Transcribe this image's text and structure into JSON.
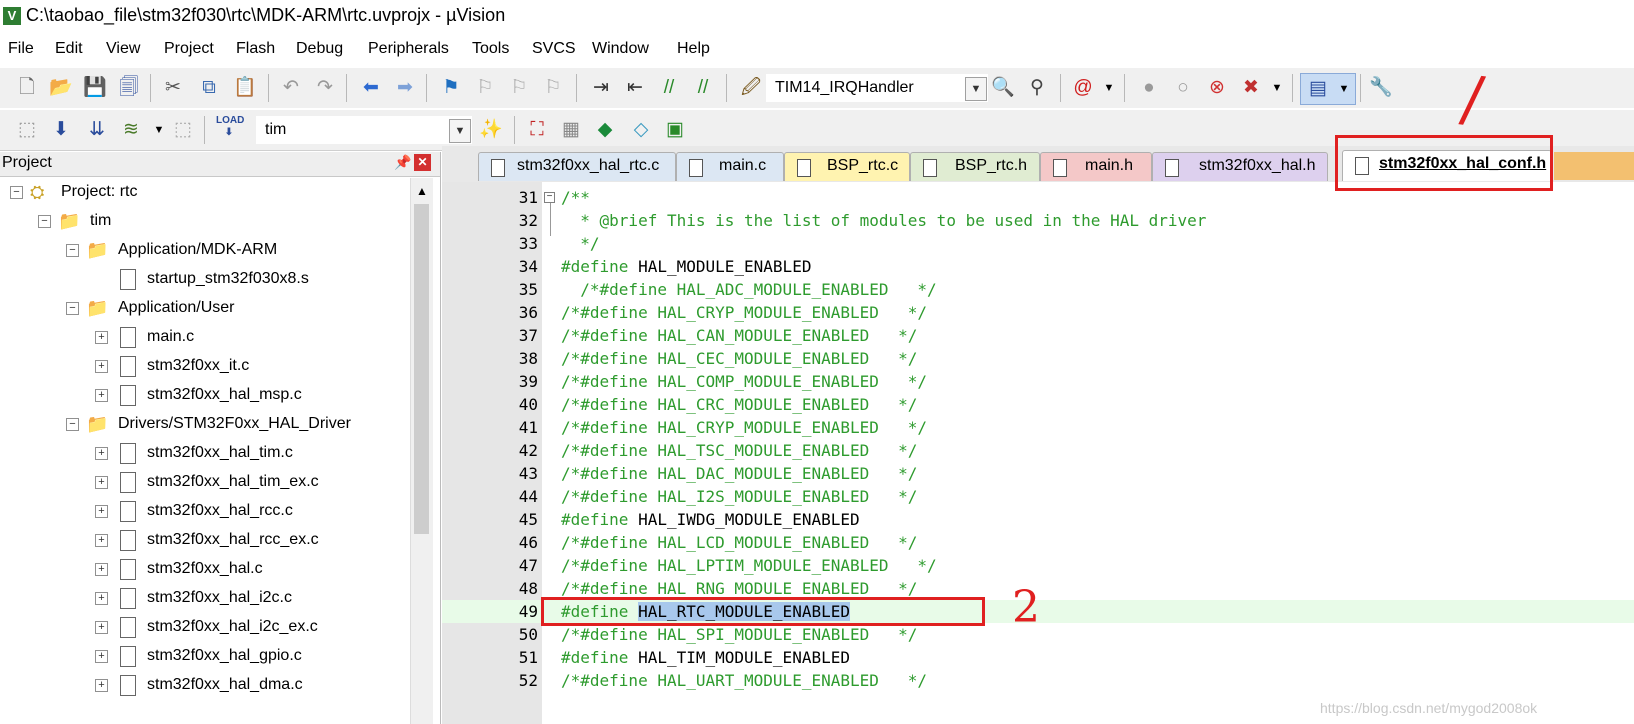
{
  "window": {
    "title": "C:\\taobao_file\\stm32f030\\rtc\\MDK-ARM\\rtc.uvprojx - µVision",
    "app_icon": "V"
  },
  "menu": [
    "File",
    "Edit",
    "View",
    "Project",
    "Flash",
    "Debug",
    "Peripherals",
    "Tools",
    "SVCS",
    "Window",
    "Help"
  ],
  "toolbar": {
    "function_combo": "TIM14_IRQHandler",
    "target_combo": "tim"
  },
  "project": {
    "title": "Project",
    "tree": [
      {
        "label": "Project: rtc"
      },
      {
        "label": "tim"
      },
      {
        "label": "Application/MDK-ARM"
      },
      {
        "label": "startup_stm32f030x8.s"
      },
      {
        "label": "Application/User"
      },
      {
        "label": "main.c"
      },
      {
        "label": "stm32f0xx_it.c"
      },
      {
        "label": "stm32f0xx_hal_msp.c"
      },
      {
        "label": "Drivers/STM32F0xx_HAL_Driver"
      },
      {
        "label": "stm32f0xx_hal_tim.c"
      },
      {
        "label": "stm32f0xx_hal_tim_ex.c"
      },
      {
        "label": "stm32f0xx_hal_rcc.c"
      },
      {
        "label": "stm32f0xx_hal_rcc_ex.c"
      },
      {
        "label": "stm32f0xx_hal.c"
      },
      {
        "label": "stm32f0xx_hal_i2c.c"
      },
      {
        "label": "stm32f0xx_hal_i2c_ex.c"
      },
      {
        "label": "stm32f0xx_hal_gpio.c"
      },
      {
        "label": "stm32f0xx_hal_dma.c"
      }
    ]
  },
  "tabs": [
    {
      "label": "stm32f0xx_hal_rtc.c"
    },
    {
      "label": "main.c"
    },
    {
      "label": "BSP_rtc.c"
    },
    {
      "label": "BSP_rtc.h"
    },
    {
      "label": "main.h"
    },
    {
      "label": "stm32f0xx_hal.h"
    },
    {
      "label": "stm32f0xx_hal_conf.h"
    }
  ],
  "editor": {
    "lines": [
      {
        "num": "31",
        "text": "/**"
      },
      {
        "num": "32",
        "text": "  * @brief This is the list of modules to be used in the HAL driver"
      },
      {
        "num": "33",
        "text": "  */"
      },
      {
        "num": "34",
        "text": "#define HAL_MODULE_ENABLED"
      },
      {
        "num": "35",
        "text": "  /*#define HAL_ADC_MODULE_ENABLED   */"
      },
      {
        "num": "36",
        "text": "/*#define HAL_CRYP_MODULE_ENABLED   */"
      },
      {
        "num": "37",
        "text": "/*#define HAL_CAN_MODULE_ENABLED   */"
      },
      {
        "num": "38",
        "text": "/*#define HAL_CEC_MODULE_ENABLED   */"
      },
      {
        "num": "39",
        "text": "/*#define HAL_COMP_MODULE_ENABLED   */"
      },
      {
        "num": "40",
        "text": "/*#define HAL_CRC_MODULE_ENABLED   */"
      },
      {
        "num": "41",
        "text": "/*#define HAL_CRYP_MODULE_ENABLED   */"
      },
      {
        "num": "42",
        "text": "/*#define HAL_TSC_MODULE_ENABLED   */"
      },
      {
        "num": "43",
        "text": "/*#define HAL_DAC_MODULE_ENABLED   */"
      },
      {
        "num": "44",
        "text": "/*#define HAL_I2S_MODULE_ENABLED   */"
      },
      {
        "num": "45",
        "text": "#define HAL_IWDG_MODULE_ENABLED"
      },
      {
        "num": "46",
        "text": "/*#define HAL_LCD_MODULE_ENABLED   */"
      },
      {
        "num": "47",
        "text": "/*#define HAL_LPTIM_MODULE_ENABLED   */"
      },
      {
        "num": "48",
        "text": "/*#define HAL_RNG_MODULE_ENABLED   */"
      },
      {
        "num": "49",
        "kw": "#define ",
        "sel": "HAL_RTC_MODULE_ENABLED"
      },
      {
        "num": "50",
        "text": "/*#define HAL_SPI_MODULE_ENABLED   */"
      },
      {
        "num": "51",
        "text": "#define HAL_TIM_MODULE_ENABLED"
      },
      {
        "num": "52",
        "text": "/*#define HAL_UART_MODULE_ENABLED   */"
      }
    ]
  },
  "annotations": {
    "mark_1": "/",
    "mark_2": "2"
  },
  "watermark": "https://blog.csdn.net/mygod2008ok",
  "colors": {
    "comment": "#2e9b2e",
    "macro": "#2e9b2e",
    "normal": "#000000",
    "annotation": "#e02020",
    "tab_rtc_c": "#dce7f3",
    "tab_main_c": "#dce7f3",
    "tab_bsp_rtc_c": "#fff3b0",
    "tab_bsp_rtc_h": "#e0ecd2",
    "tab_main_h": "#f4c8c8",
    "tab_hal_h": "#ddd0ee",
    "tab_active": "#ffffff"
  }
}
